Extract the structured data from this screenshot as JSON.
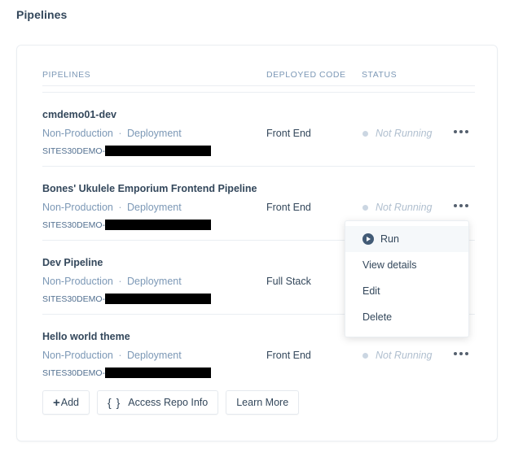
{
  "page": {
    "title": "Pipelines"
  },
  "table": {
    "columns": {
      "pipelines": "PIPELINES",
      "deployed_code": "DEPLOYED CODE",
      "status": "STATUS"
    },
    "rows": [
      {
        "name": "cmdemo01-dev",
        "environment": "Non-Production",
        "separator": "·",
        "type": "Deployment",
        "repo_prefix": "SITES30DEMO-",
        "repo_redacted": true,
        "deployed_code": "Front End",
        "status": "Not Running",
        "menu_label": "kebab-menu"
      },
      {
        "name": "Bones' Ukulele Emporium Frontend Pipeline",
        "environment": "Non-Production",
        "separator": "·",
        "type": "Deployment",
        "repo_prefix": "SITES30DEMO-",
        "repo_redacted": true,
        "deployed_code": "Front End",
        "status": "Not Running",
        "menu_label": "kebab-menu"
      },
      {
        "name": "Dev Pipeline",
        "environment": "Non-Production",
        "separator": "·",
        "type": "Deployment",
        "repo_prefix": "SITES30DEMO-",
        "repo_redacted": true,
        "deployed_code": "Full Stack",
        "status": "",
        "menu_label": "kebab-menu"
      },
      {
        "name": "Hello world theme",
        "environment": "Non-Production",
        "separator": "·",
        "type": "Deployment",
        "repo_prefix": "SITES30DEMO-",
        "repo_redacted": true,
        "deployed_code": "Front End",
        "status": "Not Running",
        "menu_label": "kebab-menu"
      }
    ]
  },
  "footer": {
    "add_plus": "+",
    "add_label": "Add",
    "access_repo_braces": "{ }",
    "access_repo_label": "Access Repo Info",
    "learn_more_label": "Learn More"
  },
  "context_menu": {
    "open_for_row_index": 1,
    "items": [
      {
        "label": "Run",
        "icon": "play-icon",
        "highlighted": true
      },
      {
        "label": "View details",
        "icon": "",
        "highlighted": false
      },
      {
        "label": "Edit",
        "icon": "",
        "highlighted": false
      },
      {
        "label": "Delete",
        "icon": "",
        "highlighted": false
      }
    ]
  },
  "colors": {
    "text_primary": "#33475b",
    "text_muted": "#7c98b6",
    "border": "#eaeef2",
    "status_dot": "#cbd6e2",
    "menu_highlight": "#f5f8fa",
    "play_icon": "#425b76"
  }
}
